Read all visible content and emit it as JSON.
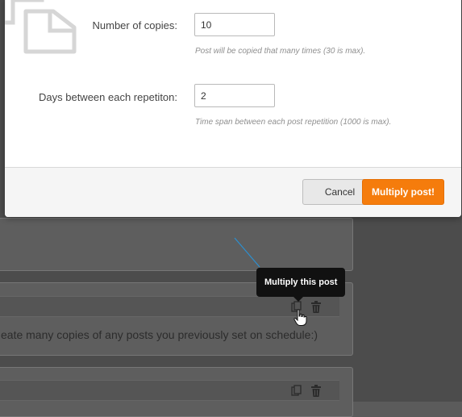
{
  "modal": {
    "copies": {
      "label": "Number of copies:",
      "value": "10",
      "hint": "Post will be copied that many times (30 is max)."
    },
    "days": {
      "label": "Days between each repetiton:",
      "value": "2",
      "hint": "Time span between each post repetition (1000 is max)."
    },
    "buttons": {
      "cancel": "Cancel",
      "submit": "Multiply post!"
    },
    "accent_color": "#f57c0c"
  },
  "background": {
    "post_text": "eate many copies of any posts you previously set on schedule:)",
    "tooltip": "Multiply this post"
  }
}
